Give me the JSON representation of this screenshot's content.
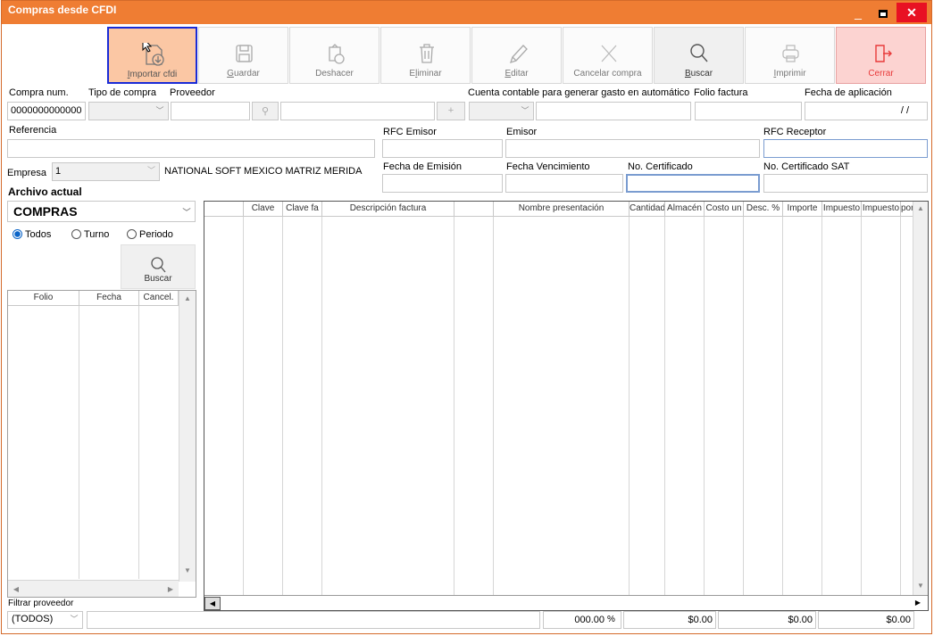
{
  "window": {
    "title": "Compras desde CFDI",
    "min": "_",
    "close": "✕"
  },
  "toolbar": [
    {
      "label": "Importar cfdi",
      "key": "I",
      "rest": "mportar cfdi"
    },
    {
      "label": "Guardar",
      "key": "G",
      "rest": "uardar"
    },
    {
      "label": "Deshacer",
      "key": "",
      "rest": "Deshacer"
    },
    {
      "label": "Eliminar",
      "key": "E",
      "rest": "liminar"
    },
    {
      "label": "Editar",
      "key": "E",
      "rest": "ditar"
    },
    {
      "label": "Cancelar compra",
      "key": "",
      "rest": "Cancelar compra"
    },
    {
      "label": "Buscar",
      "key": "B",
      "rest": "uscar"
    },
    {
      "label": "Imprimir",
      "key": "I",
      "rest": "mprimir"
    },
    {
      "label": "Cerrar",
      "key": "",
      "rest": "Cerrar"
    }
  ],
  "form": {
    "compra_num_label": "Compra num.",
    "compra_num_value": "0000000000000",
    "tipo_compra_label": "Tipo de compra",
    "proveedor_label": "Proveedor",
    "cuenta_label": "Cuenta contable para generar gasto en automático",
    "folio_factura_label": "Folio factura",
    "fecha_aplicacion_label": "Fecha de aplicación",
    "fecha_aplicacion_value": "/  /",
    "referencia_label": "Referencia",
    "rfc_emisor_label": "RFC Emisor",
    "emisor_label": "Emisor",
    "rfc_receptor_label": "RFC Receptor",
    "empresa_label": "Empresa",
    "empresa_value": "1",
    "empresa_name": "NATIONAL SOFT MEXICO MATRIZ MERIDA",
    "fecha_emision_label": "Fecha de Emisión",
    "fecha_vencimiento_label": "Fecha Vencimiento",
    "no_certificado_label": "No. Certificado",
    "no_certificado_sat_label": "No. Certificado SAT"
  },
  "left": {
    "archivo_label": "Archivo actual",
    "archivo_value": "COMPRAS",
    "radios": [
      "Todos",
      "Turno",
      "Periodo"
    ],
    "selected_radio": "Todos",
    "buscar_label": "Buscar",
    "columns": [
      "Folio",
      "Fecha",
      "Cancel."
    ],
    "filtrar_label": "Filtrar proveedor",
    "filtrar_value": "(TODOS)"
  },
  "main_grid": {
    "columns": [
      "",
      "Clave",
      "Clave fa",
      "Descripción factura",
      "",
      "Nombre presentación",
      "Cantidad",
      "Almacén",
      "Costo un",
      "Desc. %",
      "Importe",
      "Impuesto",
      "Impuesto",
      "por"
    ]
  },
  "totals": {
    "pct_value": "000.00",
    "pct_symbol": "%",
    "total1": "$0.00",
    "total2": "$0.00",
    "total3": "$0.00"
  },
  "colors": {
    "titlebar": "#ef7d33",
    "close": "#e81123",
    "active_border": "#1a2bd6"
  }
}
